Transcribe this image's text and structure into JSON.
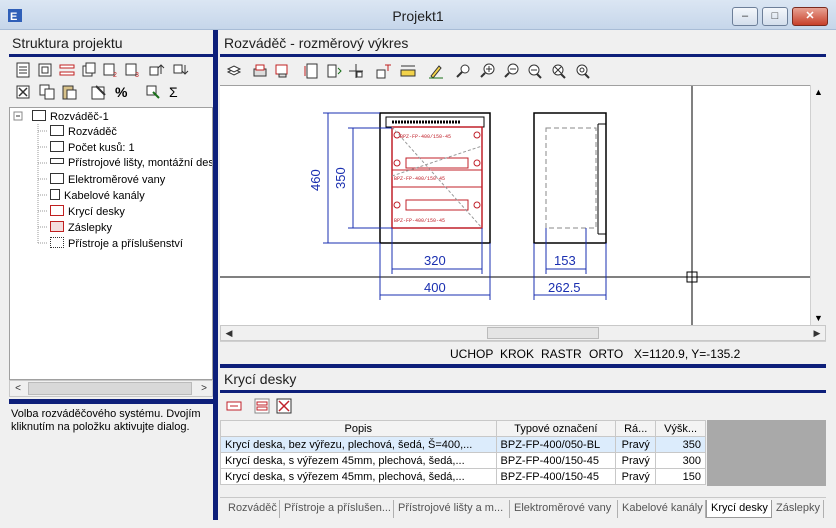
{
  "window": {
    "title": "Projekt1",
    "minimize": "‒",
    "maximize": "□",
    "close": "✕"
  },
  "left": {
    "header": "Struktura projektu",
    "tree": {
      "root": "Rozváděč-1",
      "items": [
        "Rozváděč",
        "Počet kusů: 1",
        "Přístrojové lišty, montážní des",
        "Elektroměrové vany",
        "Kabelové kanály",
        "Krycí desky",
        "Záslepky",
        "Přístroje a příslušenství"
      ]
    },
    "toolbar_percent": "%",
    "toolbar_sigma": "Σ",
    "description": "Volba rozváděčového systému. Dvojím kliknutím na položku aktivujte dialog."
  },
  "drawing": {
    "header": "Rozváděč - rozměrový výkres",
    "dims": {
      "height_outer": "460",
      "height_inner": "350",
      "width_inner": "320",
      "width_outer": "400",
      "depth_inner": "153",
      "depth_outer": "262.5"
    },
    "panel_text": "BPZ-FP-400/150-45"
  },
  "status": {
    "uchop": "UCHOP",
    "krok": "KROK",
    "rastr": "RASTR",
    "orto": "ORTO",
    "coords": "X=1120.9, Y=-135.2"
  },
  "bottom": {
    "header": "Krycí desky",
    "columns": [
      "Popis",
      "Typové označení",
      "Rá...",
      "Výšk..."
    ],
    "rows": [
      [
        "Krycí deska, bez výřezu, plechová, šedá, Š=400,...",
        "BPZ-FP-400/050-BL",
        "Pravý",
        "350"
      ],
      [
        "Krycí deska, s výřezem 45mm, plechová, šedá,...",
        "BPZ-FP-400/150-45",
        "Pravý",
        "300"
      ],
      [
        "Krycí deska, s výřezem 45mm, plechová, šedá,...",
        "BPZ-FP-400/150-45",
        "Pravý",
        "150"
      ]
    ],
    "tabs": [
      "Rozváděč",
      "Přístroje a příslušen...",
      "Přístrojové lišty a m...",
      "Elektroměrové vany",
      "Kabelové kanály",
      "Krycí desky",
      "Záslepky"
    ],
    "active_tab": "Krycí desky"
  },
  "colors": {
    "accent_bar": "#0d1f7a",
    "drawing_red": "#c0202a",
    "dim_blue": "#1a2fb0"
  }
}
